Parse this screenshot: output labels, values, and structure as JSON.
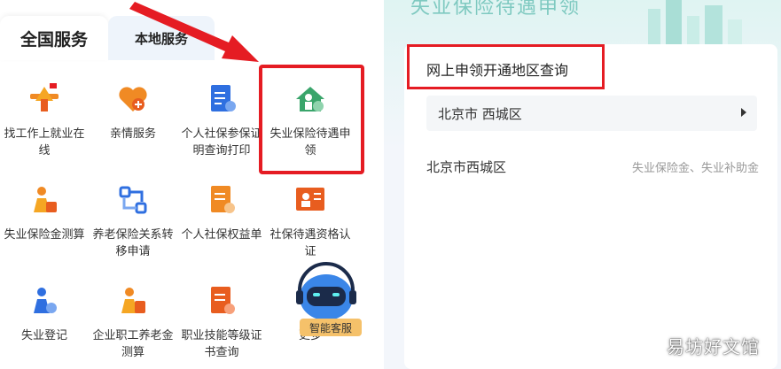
{
  "left": {
    "tabs": [
      {
        "label": "全国服务"
      },
      {
        "label": "本地服务"
      }
    ],
    "services": [
      {
        "label": "找工作上就业在\n线",
        "icon": "job-icon"
      },
      {
        "label": "亲情服务",
        "icon": "heart-plus-icon"
      },
      {
        "label": "个人社保参保证\n明查询打印",
        "icon": "certificate-icon"
      },
      {
        "label": "失业保险待遇申\n领",
        "icon": "unemployment-claim-icon"
      },
      {
        "label": "失业保险金测算",
        "icon": "unemployment-calc-icon"
      },
      {
        "label": "养老保险关系转\n移申请",
        "icon": "pension-transfer-icon"
      },
      {
        "label": "个人社保权益单",
        "icon": "rights-sheet-icon"
      },
      {
        "label": "社保待遇资格认\n证",
        "icon": "qualification-icon"
      },
      {
        "label": "失业登记",
        "icon": "unemployment-register-icon"
      },
      {
        "label": "企业职工养老金\n测算",
        "icon": "pension-calc-icon"
      },
      {
        "label": "职业技能等级证\n书查询",
        "icon": "skill-cert-icon"
      },
      {
        "label": "更多",
        "icon": "more-icon"
      }
    ],
    "robot_label": "智能客服"
  },
  "right": {
    "bg_title": "失业保险待遇申领",
    "card_title": "网上申领开通地区查询",
    "selector_value": "北京市 西城区",
    "region_name": "北京市西城区",
    "benefits": "失业保险金、失业补助金",
    "watermark": "易坊好文馆"
  },
  "colors": {
    "highlight": "#e51c23",
    "orange": "#f08a24",
    "blue": "#2f6fe0",
    "green": "#3aa56b"
  }
}
